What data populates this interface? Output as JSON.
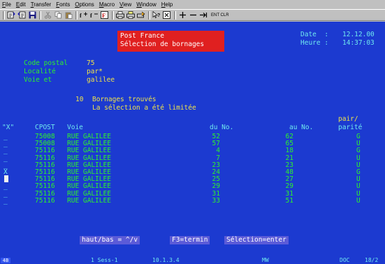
{
  "menubar": [
    "File",
    "Edit",
    "Transfer",
    "Fonts",
    "Options",
    "Macro",
    "View",
    "Window",
    "Help"
  ],
  "toolbar": {
    "icons": [
      "send-icon",
      "receive-icon",
      "save-icon",
      "cut-icon",
      "copy-icon",
      "paste-icon",
      "font-up-icon",
      "font-down-icon",
      "palette-icon",
      "print-icon",
      "print-screen-icon",
      "print-setup-icon",
      "help-pointer-icon",
      "close-box-icon",
      "plus-icon",
      "minus-icon",
      "tab-icon"
    ],
    "ent_clr": "ENT CLR"
  },
  "screen": {
    "title_line1": "Post France",
    "title_line2": "Sélection de bornages",
    "date_label": "Date  :",
    "date_value": "12.12.00",
    "time_label": "Heure :",
    "time_value": "14:37:03",
    "fields": [
      {
        "label": "Code postal",
        "value": "75"
      },
      {
        "label": "Localité",
        "value": "par*"
      },
      {
        "label": "Voie et",
        "value": "galilee"
      }
    ],
    "found_count": "10",
    "found_text": "Bornages trouvés",
    "limited_text": "La sélection a été limitée",
    "headers": {
      "sel": "\"X\"",
      "cpost": "CPOST",
      "voie": "Voie",
      "du_no": "du No.",
      "au_no": "au No.",
      "pair1": "pair/",
      "pair2": "parité"
    },
    "rows": [
      {
        "sel": "_",
        "cpost": "75008",
        "voie": "RUE GALILEE",
        "du": "52",
        "au": "62",
        "parite": "G"
      },
      {
        "sel": "_",
        "cpost": "75008",
        "voie": "RUE GALILEE",
        "du": "57",
        "au": "65",
        "parite": "U"
      },
      {
        "sel": "_",
        "cpost": "75116",
        "voie": "RUE GALILEE",
        "du": "4",
        "au": "18",
        "parite": "G"
      },
      {
        "sel": "_",
        "cpost": "75116",
        "voie": "RUE GALILEE",
        "du": "7",
        "au": "21",
        "parite": "U"
      },
      {
        "sel": "_",
        "cpost": "75116",
        "voie": "RUE GALILEE",
        "du": "23",
        "au": "23",
        "parite": "U"
      },
      {
        "sel": "X",
        "cpost": "75116",
        "voie": "RUE GALILEE",
        "du": "24",
        "au": "48",
        "parite": "G"
      },
      {
        "sel": "",
        "cpost": "75116",
        "voie": "RUE GALILEE",
        "du": "25",
        "au": "27",
        "parite": "U"
      },
      {
        "sel": "_",
        "cpost": "75116",
        "voie": "RUE GALILEE",
        "du": "29",
        "au": "29",
        "parite": "U"
      },
      {
        "sel": "_",
        "cpost": "75116",
        "voie": "RUE GALILEE",
        "du": "31",
        "au": "31",
        "parite": "U"
      },
      {
        "sel": "_",
        "cpost": "75116",
        "voie": "RUE GALILEE",
        "du": "33",
        "au": "51",
        "parite": "U"
      }
    ],
    "fkeys": {
      "scroll": "haut/bas = ^/v",
      "f3": "F3=termin",
      "enter": "Sélection=enter"
    }
  },
  "status": {
    "indicator": "4B",
    "session": "1 Sess-1",
    "address": "10.1.3.4",
    "mode": "MW",
    "mode2": "DOC",
    "cursor_pos": "18/2"
  },
  "colors": {
    "screen_bg": "#1c3ad0",
    "title_bg": "#e02020",
    "green": "#2cf22c",
    "yellow": "#efe24a",
    "cyan": "#6ee7ee"
  }
}
